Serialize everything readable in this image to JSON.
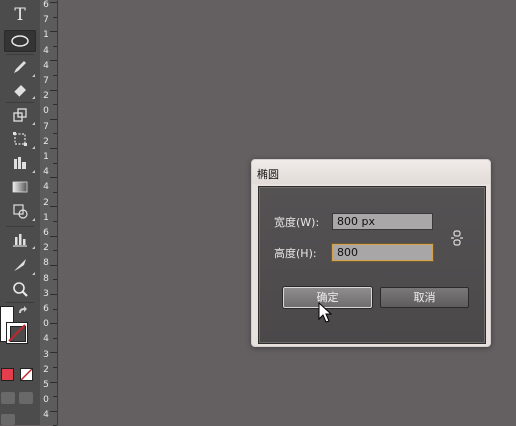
{
  "toolbar": {
    "tools": [
      {
        "name": "type-tool",
        "icon": "type-icon",
        "glyph": "T"
      },
      {
        "name": "ellipse-tool",
        "icon": "ellipse-icon",
        "active": true
      },
      {
        "name": "pencil-tool",
        "icon": "pencil-icon"
      },
      {
        "name": "eraser-tool",
        "icon": "eraser-icon"
      },
      {
        "name": "scale-tool",
        "icon": "scale-icon"
      },
      {
        "name": "free-transform-tool",
        "icon": "free-transform-icon"
      },
      {
        "name": "shape-builder-tool",
        "icon": "shape-builder-icon"
      },
      {
        "name": "gradient-tool",
        "icon": "gradient-icon"
      },
      {
        "name": "live-paint-tool",
        "icon": "live-paint-icon"
      },
      {
        "name": "graph-tool",
        "icon": "bar-graph-icon"
      },
      {
        "name": "slice-tool",
        "icon": "slice-icon"
      },
      {
        "name": "zoom-tool",
        "icon": "magnifier-icon"
      }
    ],
    "fill_color": "#ffffff",
    "stroke_color": "#c0272d"
  },
  "ruler": {
    "labels": [
      "6",
      "7",
      "1",
      "4",
      "4",
      "7",
      "2",
      "0",
      "7",
      "2",
      "1",
      "4",
      "4",
      "2",
      "1",
      "6",
      "2",
      "8",
      "8",
      "3",
      "6",
      "0",
      "4",
      "3",
      "2",
      "5",
      "0",
      "4"
    ]
  },
  "dialog": {
    "title": "椭圆",
    "width_label": "宽度(W):",
    "width_value": "800 px",
    "height_label": "高度(H):",
    "height_value": "800",
    "ok_label": "确定",
    "cancel_label": "取消",
    "link_icon": "constrain-proportions-icon"
  },
  "colors": {
    "canvas": "#646062",
    "panel": "#4d4c4c",
    "focus_border": "#d4a24c"
  }
}
